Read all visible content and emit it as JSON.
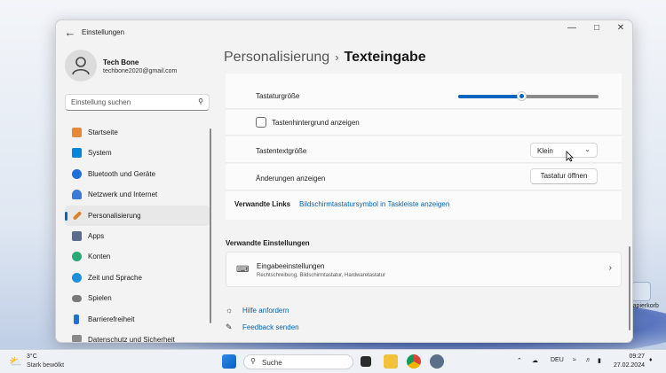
{
  "window": {
    "title": "Einstellungen"
  },
  "user": {
    "name": "Tech Bone",
    "email": "techbone2020@gmail.com"
  },
  "search": {
    "placeholder": "Einstellung suchen"
  },
  "sidebar": {
    "items": [
      {
        "label": "Startseite",
        "icon": "home-icon",
        "color": "#e58a3a"
      },
      {
        "label": "System",
        "icon": "monitor-icon",
        "color": "#0a84d6"
      },
      {
        "label": "Bluetooth und Geräte",
        "icon": "bluetooth-icon",
        "color": "#1e6fd9"
      },
      {
        "label": "Netzwerk und Internet",
        "icon": "wifi-icon",
        "color": "#3a7bd5"
      },
      {
        "label": "Personalisierung",
        "icon": "brush-icon",
        "color": "#d9822b"
      },
      {
        "label": "Apps",
        "icon": "apps-icon",
        "color": "#5a6b8c"
      },
      {
        "label": "Konten",
        "icon": "person-icon",
        "color": "#2aa876"
      },
      {
        "label": "Zeit und Sprache",
        "icon": "globe-clock-icon",
        "color": "#1e8fd6"
      },
      {
        "label": "Spielen",
        "icon": "gamepad-icon",
        "color": "#7a7a7a"
      },
      {
        "label": "Barrierefreiheit",
        "icon": "accessibility-icon",
        "color": "#1e6fd9"
      },
      {
        "label": "Datenschutz und Sicherheit",
        "icon": "shield-icon",
        "color": "#8a8a8a"
      }
    ],
    "active_index": 4
  },
  "breadcrumb": {
    "parent": "Personalisierung",
    "separator": "›",
    "current": "Texteingabe"
  },
  "settings": {
    "keyboard_size_label": "Tastaturgröße",
    "keyboard_size_value": 0.45,
    "background_checkbox_label": "Tastenhintergrund anzeigen",
    "background_checkbox_checked": false,
    "text_size_label": "Tastentextgröße",
    "text_size_value": "Klein",
    "changes_label": "Änderungen anzeigen",
    "open_keyboard_button": "Tastatur öffnen",
    "related_links_label": "Verwandte Links",
    "related_link": "Bildschirmtastatursymbol in Taskleiste anzeigen"
  },
  "related_settings": {
    "title": "Verwandte Einstellungen",
    "card_title": "Eingabeeinstellungen",
    "card_subtitle": "Rechtschreibung, Bildschirmtastatur, Hardwaretastatur"
  },
  "help": {
    "get_help": "Hilfe anfordern",
    "feedback": "Feedback senden"
  },
  "desktop": {
    "icon_label": "Papierkorb"
  },
  "taskbar": {
    "temperature": "3°C",
    "weather": "Stark bewölkt",
    "search_placeholder": "Suche",
    "language": "DEU",
    "time": "09:27",
    "date": "27.02.2024"
  }
}
